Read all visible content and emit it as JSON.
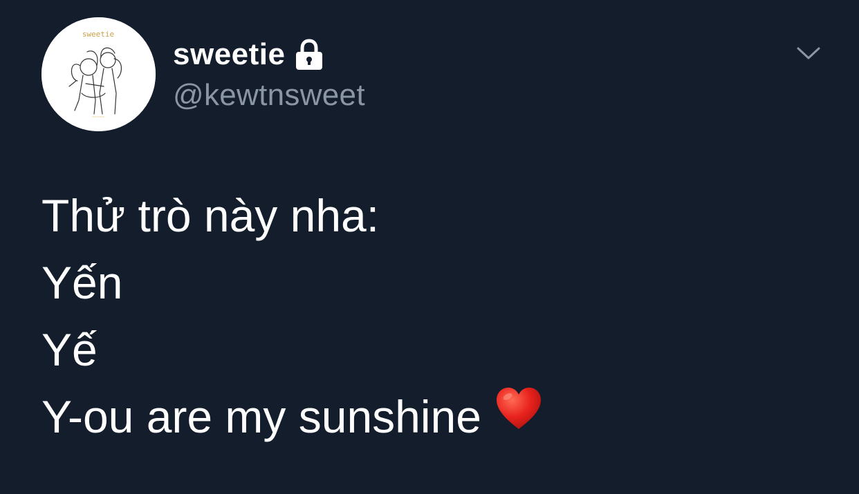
{
  "tweet": {
    "avatar": {
      "icon": "avatar-drawing-icon",
      "caption_top": "sweetie"
    },
    "display_name": "sweetie",
    "protected_icon": "lock-icon",
    "handle": "@kewtnsweet",
    "menu_icon": "chevron-down-icon",
    "lines": [
      "Thử trò này nha:",
      "Yến",
      "Yế",
      "Y-ou are my sunshine"
    ],
    "emoji": "heart-icon"
  },
  "colors": {
    "background": "#141d2b",
    "text": "#ffffff",
    "secondary_text": "#8a96a3",
    "heart": "#e8231e"
  }
}
